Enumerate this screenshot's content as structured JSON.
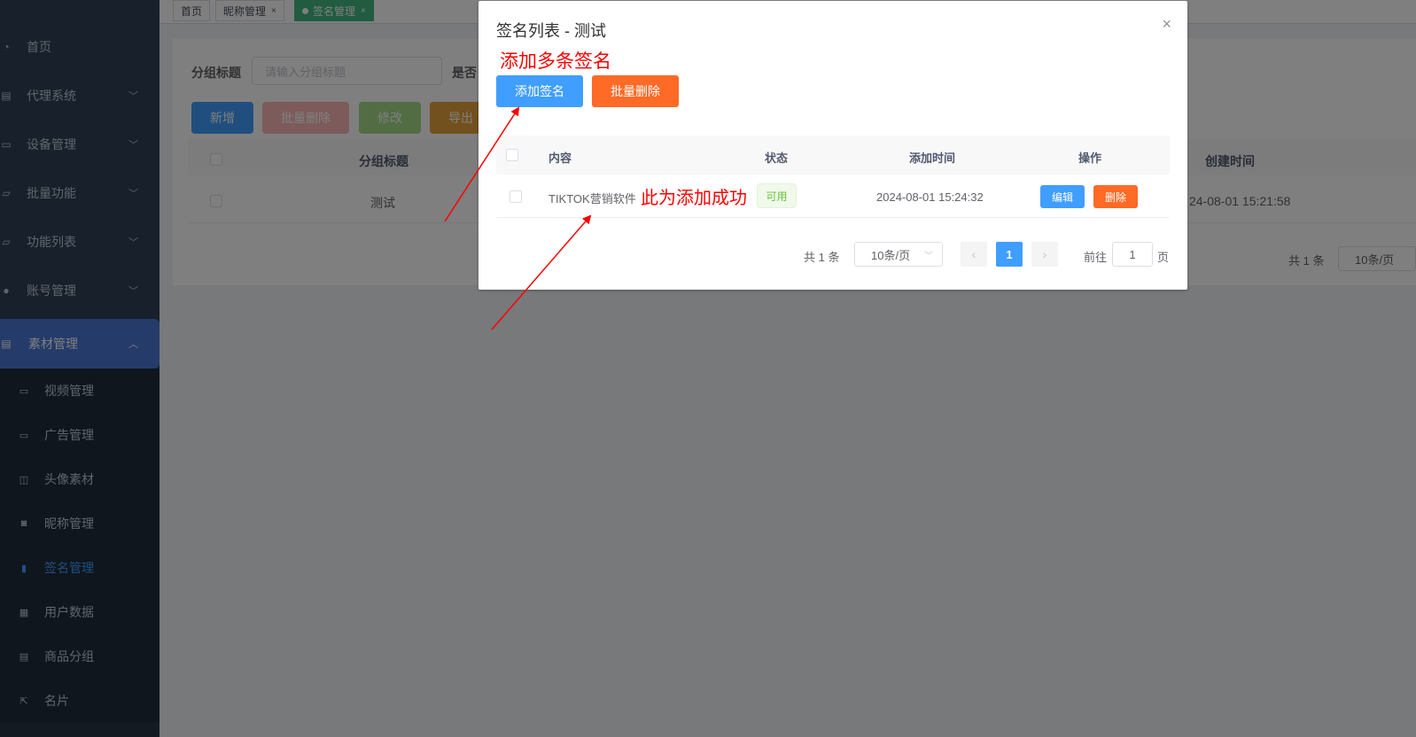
{
  "sidebar": {
    "items": [
      {
        "label": "首页",
        "icon": "dashboard-icon",
        "has_children": false
      },
      {
        "label": "代理系统",
        "icon": "doc-icon",
        "has_children": true
      },
      {
        "label": "设备管理",
        "icon": "monitor-icon",
        "has_children": true
      },
      {
        "label": "批量功能",
        "icon": "chart-icon",
        "has_children": true
      },
      {
        "label": "功能列表",
        "icon": "chart-icon",
        "has_children": true
      },
      {
        "label": "账号管理",
        "icon": "user-icon",
        "has_children": true
      },
      {
        "label": "素材管理",
        "icon": "doc-icon",
        "has_children": true,
        "expanded": true
      }
    ],
    "sub_items": [
      {
        "label": "视频管理",
        "icon": "monitor-icon"
      },
      {
        "label": "广告管理",
        "icon": "monitor-icon"
      },
      {
        "label": "头像素材",
        "icon": "book-icon"
      },
      {
        "label": "昵称管理",
        "icon": "target-icon"
      },
      {
        "label": "签名管理",
        "icon": "info-icon",
        "current": true
      },
      {
        "label": "用户数据",
        "icon": "table-icon"
      },
      {
        "label": "商品分组",
        "icon": "list-icon"
      },
      {
        "label": "名片",
        "icon": "external-icon"
      }
    ],
    "colors": {
      "bg": "#304156",
      "sub_bg": "#1f2d3d",
      "active": "#4a77d4",
      "current_text": "#409eff"
    }
  },
  "tags": [
    {
      "label": "首页",
      "active": false
    },
    {
      "label": "昵称管理",
      "active": false,
      "closable": true
    },
    {
      "label": "签名管理",
      "active": true,
      "closable": true
    }
  ],
  "search": {
    "group_title_label": "分组标题",
    "group_title_placeholder": "请输入分组标题",
    "second_label_partial": "是否"
  },
  "toolbar": {
    "add": "新增",
    "batch_delete": "批量删除",
    "modify": "修改",
    "export": "导出"
  },
  "table": {
    "headers": {
      "group_title": "分组标题",
      "created_time": "创建时间"
    },
    "rows": [
      {
        "group_title": "测试",
        "created_time_partial": "24-08-01 15:21:58"
      }
    ]
  },
  "pagination": {
    "total": "共 1 条",
    "page_size": "10条/页"
  },
  "dialog": {
    "title": "签名列表 - 测试",
    "close": "×",
    "annotation_top": "添加多条签名",
    "add_button": "添加签名",
    "batch_delete_button": "批量删除",
    "headers": {
      "content": "内容",
      "status": "状态",
      "added_time": "添加时间",
      "operation": "操作"
    },
    "rows": [
      {
        "content": "TIKTOK营销软件",
        "status": "可用",
        "added_time": "2024-08-01 15:24:32",
        "edit": "编辑",
        "delete": "删除"
      }
    ],
    "annotation_row": "此为添加成功",
    "pagination": {
      "total": "共 1 条",
      "page_size": "10条/页",
      "current_page": "1",
      "goto_label": "前往",
      "goto_value": "1",
      "page_suffix": "页",
      "prev": "‹",
      "next": "›"
    },
    "colors": {
      "blue": "#409eff",
      "orange": "#ff6a26",
      "annotation": "#ff0000"
    }
  }
}
